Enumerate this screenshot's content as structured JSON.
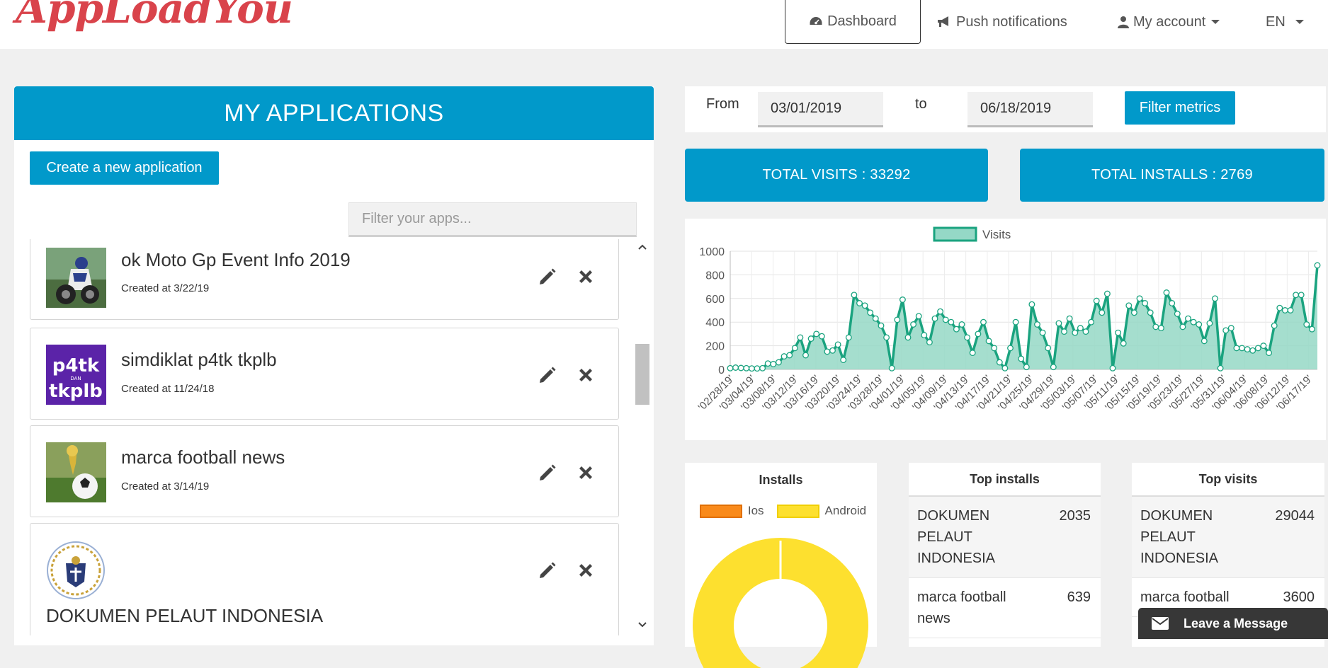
{
  "header": {
    "logo_text": "AppLoadYou",
    "nav": [
      {
        "label": "Dashboard",
        "icon": "dashboard-icon"
      },
      {
        "label": "Push notifications",
        "icon": "bullhorn-icon"
      },
      {
        "label": "My account",
        "icon": "user-icon"
      },
      {
        "label": "EN",
        "icon": "chevron-down-icon"
      }
    ]
  },
  "apps": {
    "title": "MY APPLICATIONS",
    "create_label": "Create a new application",
    "filter_placeholder": "Filter your apps...",
    "items": [
      {
        "name": "ok Moto Gp Event Info 2019",
        "created": "Created at 3/22/19"
      },
      {
        "name": "simdiklat p4tk tkplb",
        "created": "Created at 11/24/18"
      },
      {
        "name": "marca football news",
        "created": "Created at 3/14/19"
      },
      {
        "name": "DOKUMEN PELAUT INDONESIA",
        "created": ""
      }
    ]
  },
  "filters": {
    "from_label": "From",
    "from_value": "03/01/2019",
    "to_label": "to",
    "to_value": "06/18/2019",
    "button_label": "Filter metrics"
  },
  "stats": {
    "visits": "TOTAL VISITS : 33292",
    "installs": "TOTAL INSTALLS : 2769"
  },
  "chart_data": {
    "type": "area",
    "legend": [
      "Visits"
    ],
    "colors": {
      "line": "#1aa37f",
      "fill": "#95d8c6"
    },
    "ylim": [
      0,
      1000
    ],
    "yticks": [
      0,
      200,
      400,
      600,
      800,
      1000
    ],
    "xtick_labels": [
      "'02/28/19'",
      "'03/04/19'",
      "'03/08/19'",
      "'03/12/19'",
      "'03/16/19'",
      "'03/20/19'",
      "'03/24/19'",
      "'03/28/19'",
      "'04/01/19'",
      "'04/05/19'",
      "'04/09/19'",
      "'04/13/19'",
      "'04/17/19'",
      "'04/21/19'",
      "'04/25/19'",
      "'04/29/19'",
      "'05/03/19'",
      "'05/07/19'",
      "'05/11/19'",
      "'05/15/19'",
      "'05/19/19'",
      "'05/23/19'",
      "'05/27/19'",
      "'05/31/19'",
      "'06/04/19'",
      "'06/08/19'",
      "'06/12/19'",
      "'06/17/19'"
    ],
    "values": [
      10,
      15,
      12,
      10,
      8,
      8,
      10,
      50,
      45,
      60,
      110,
      120,
      180,
      270,
      120,
      260,
      300,
      280,
      150,
      160,
      210,
      80,
      270,
      630,
      560,
      540,
      480,
      430,
      370,
      270,
      10,
      420,
      590,
      270,
      380,
      450,
      290,
      230,
      430,
      490,
      420,
      400,
      340,
      380,
      270,
      140,
      300,
      400,
      240,
      180,
      60,
      10,
      180,
      400,
      90,
      20,
      550,
      380,
      310,
      180,
      20,
      390,
      320,
      430,
      310,
      350,
      320,
      400,
      580,
      480,
      640,
      10,
      310,
      220,
      540,
      480,
      600,
      560,
      480,
      360,
      350,
      650,
      560,
      470,
      360,
      430,
      400,
      380,
      240,
      390,
      600,
      10,
      330,
      350,
      180,
      180,
      170,
      160,
      180,
      200,
      140,
      370,
      520,
      500,
      500,
      630,
      630,
      380,
      340,
      880
    ],
    "xlabel": "",
    "ylabel": ""
  },
  "installs_panel": {
    "title": "Installs",
    "legend": [
      {
        "label": "Ios",
        "color": "#f98a1b"
      },
      {
        "label": "Android",
        "color": "#fde02f"
      }
    ]
  },
  "top_installs": {
    "title": "Top installs",
    "rows": [
      {
        "name": "DOKUMEN PELAUT INDONESIA",
        "value": "2035"
      },
      {
        "name": "marca football news",
        "value": "639"
      }
    ]
  },
  "top_visits": {
    "title": "Top visits",
    "rows": [
      {
        "name": "DOKUMEN PELAUT INDONESIA",
        "value": "29044"
      },
      {
        "name": "marca football",
        "value": "3600"
      }
    ]
  },
  "chat": {
    "label": "Leave a Message"
  }
}
